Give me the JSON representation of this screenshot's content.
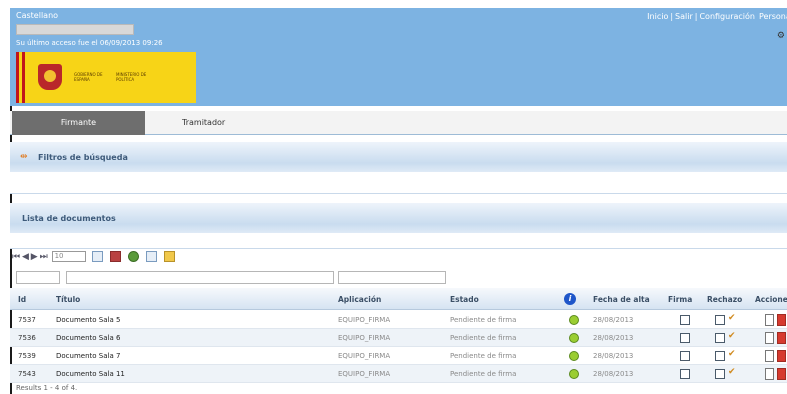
{
  "header": {
    "language": "Castellano",
    "last_access": "Su último acceso fue el 06/09/2013 09:26",
    "top_links": [
      "Inicio",
      "Salir",
      "Configuración",
      "Personal"
    ],
    "logo_text_left": "GOBIERNO DE ESPAÑA",
    "logo_text_right": "MINISTERIO DE POLÍTICA"
  },
  "tabs": [
    {
      "label": "Firmante",
      "active": true
    },
    {
      "label": "Tramitador",
      "active": false
    }
  ],
  "filters_section": {
    "title": "Filtros de búsqueda"
  },
  "documents_section": {
    "title": "Lista de documentos"
  },
  "toolbar": {
    "page_size": "10"
  },
  "table": {
    "columns": {
      "id": "Id",
      "title": "Título",
      "application": "Aplicación",
      "state": "Estado",
      "upload_date": "Fecha de alta",
      "sign": "Firma",
      "reject": "Rechazo",
      "actions": "Acciones"
    },
    "rows": [
      {
        "id": "7537",
        "title": "Documento Sala 5",
        "application": "EQUIPO_FIRMA",
        "state": "Pendiente de firma",
        "date": "28/08/2013"
      },
      {
        "id": "7536",
        "title": "Documento Sala 6",
        "application": "EQUIPO_FIRMA",
        "state": "Pendiente de firma",
        "date": "28/08/2013"
      },
      {
        "id": "7539",
        "title": "Documento Sala 7",
        "application": "EQUIPO_FIRMA",
        "state": "Pendiente de firma",
        "date": "28/08/2013"
      },
      {
        "id": "7543",
        "title": "Documento Sala 11",
        "application": "EQUIPO_FIRMA",
        "state": "Pendiente de firma",
        "date": "28/08/2013"
      }
    ]
  },
  "footer": {
    "results": "Results 1 - 4 of 4."
  },
  "colors": {
    "header_bg": "#7db3e2",
    "active_tab": "#6e6e6e",
    "logo_yellow": "#f7d417",
    "state_green": "#9acd32"
  },
  "icons": [
    "filter-toggle-icon",
    "info-icon",
    "first-page-icon",
    "prev-page-icon",
    "next-page-icon",
    "last-page-icon",
    "sign-icon",
    "reject-icon",
    "refresh-icon",
    "document-icon",
    "pdf-icon",
    "settings-icon"
  ]
}
